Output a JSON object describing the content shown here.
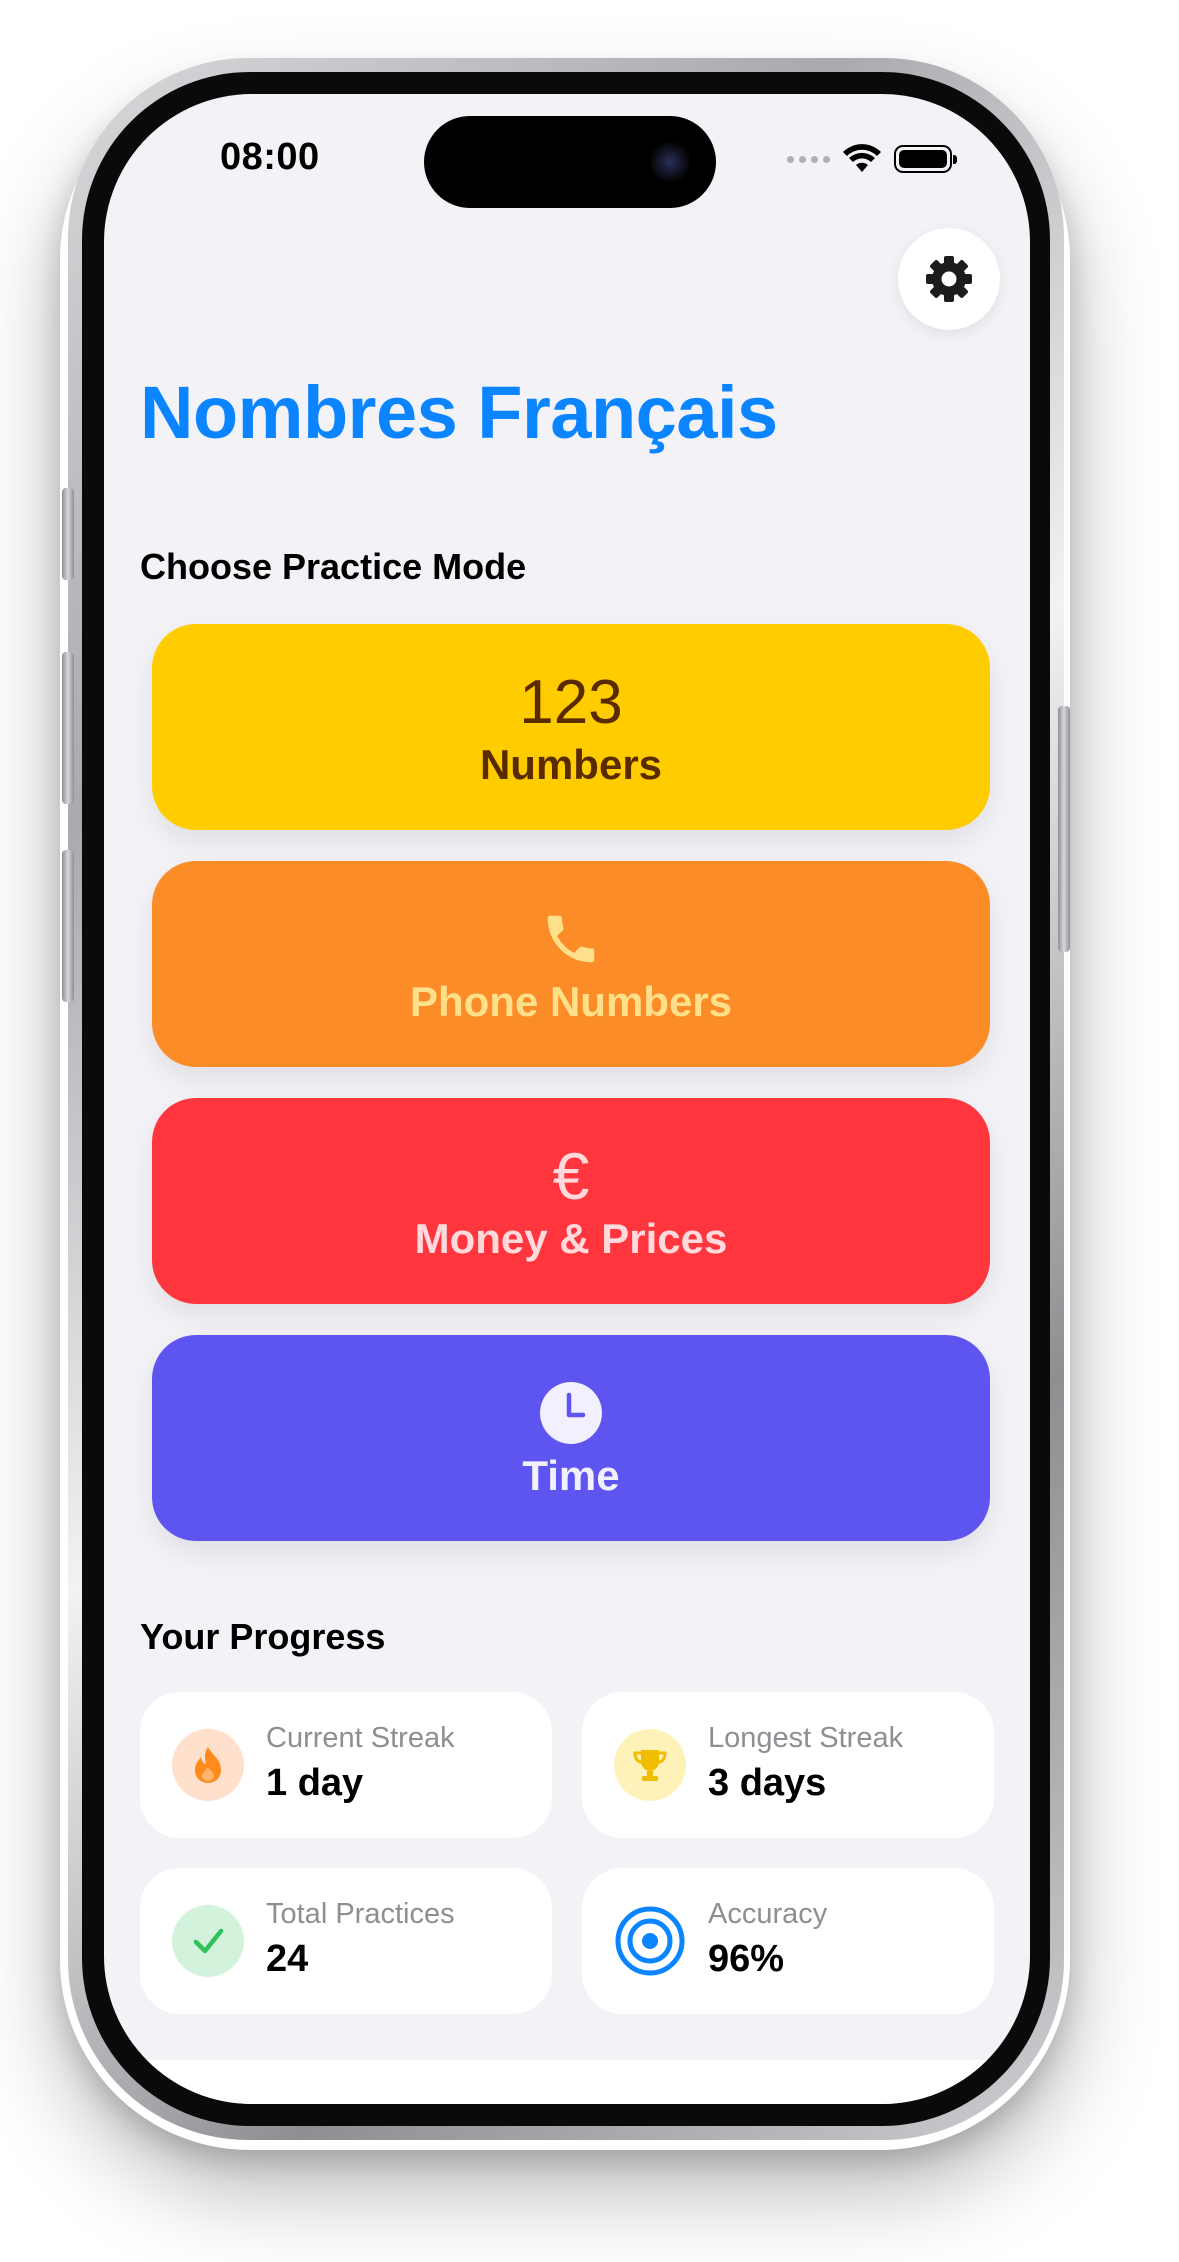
{
  "status_bar": {
    "time": "08:00"
  },
  "header": {
    "title": "Nombres Français",
    "settings_icon": "gear-icon"
  },
  "practice": {
    "section_label": "Choose Practice Mode",
    "modes": [
      {
        "icon_text": "123",
        "label": "Numbers",
        "background": "#ffcc00",
        "text_color": "#5a2a00"
      },
      {
        "icon": "phone-icon",
        "label": "Phone Numbers",
        "background": "#fb8c28",
        "text_color": "#ffe08a"
      },
      {
        "icon_text": "€",
        "label": "Money & Prices",
        "background": "#ff363e",
        "text_color": "#ffd9dc"
      },
      {
        "icon": "clock-icon",
        "label": "Time",
        "background": "#5e55f0",
        "text_color": "#f2efff"
      }
    ]
  },
  "progress": {
    "section_label": "Your Progress",
    "stats": [
      {
        "icon": "flame-icon",
        "label": "Current Streak",
        "value": "1 day"
      },
      {
        "icon": "trophy-icon",
        "label": "Longest Streak",
        "value": "3 days"
      },
      {
        "icon": "checkmark-icon",
        "label": "Total Practices",
        "value": "24"
      },
      {
        "icon": "target-icon",
        "label": "Accuracy",
        "value": "96%"
      }
    ]
  },
  "colors": {
    "accent": "#0a84ff",
    "screen_background": "#f2f2f7"
  }
}
